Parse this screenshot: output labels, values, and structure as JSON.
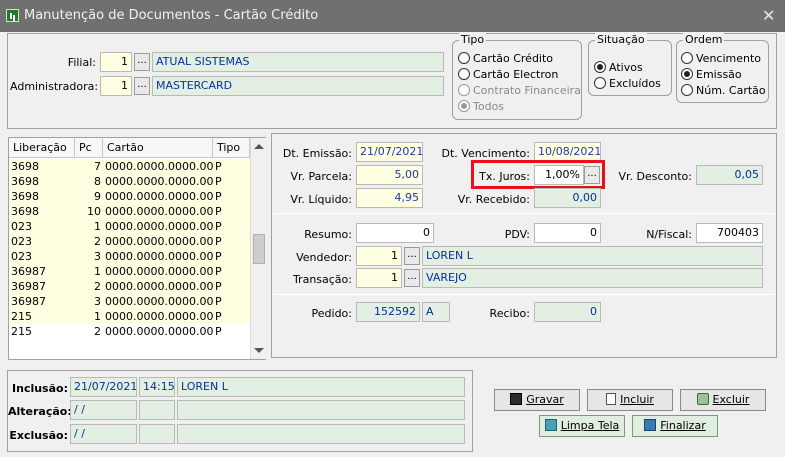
{
  "window": {
    "title": "Manutenção de Documentos - Cartão Crédito",
    "close": "✕"
  },
  "header": {
    "filial_label": "Filial:",
    "filial_code": "1",
    "filial_name": "ATUAL SISTEMAS",
    "adm_label": "Administradora:",
    "adm_code": "1",
    "adm_name": "MASTERCARD",
    "dots": "..."
  },
  "tipo": {
    "title": "Tipo",
    "options": [
      {
        "label": "Cartão Crédito",
        "selected": false,
        "enabled": true
      },
      {
        "label": "Cartão Electron",
        "selected": false,
        "enabled": true
      },
      {
        "label": "Contrato Financeira",
        "selected": false,
        "enabled": false
      },
      {
        "label": "Todos",
        "selected": true,
        "enabled": false
      }
    ]
  },
  "situacao": {
    "title": "Situação",
    "options": [
      {
        "label": "Ativos",
        "selected": true
      },
      {
        "label": "Excluídos",
        "selected": false
      }
    ]
  },
  "ordem": {
    "title": "Ordem",
    "options": [
      {
        "label": "Vencimento",
        "selected": false
      },
      {
        "label": "Emissão",
        "selected": true
      },
      {
        "label": "Núm. Cartão",
        "selected": false
      }
    ]
  },
  "grid": {
    "columns": [
      "Liberação",
      "Pc",
      "Cartão",
      "Tipo"
    ],
    "rows": [
      [
        "3698",
        "7",
        "0000.0000.0000.0000",
        "P"
      ],
      [
        "3698",
        "8",
        "0000.0000.0000.0000",
        "P"
      ],
      [
        "3698",
        "9",
        "0000.0000.0000.0000",
        "P"
      ],
      [
        "3698",
        "10",
        "0000.0000.0000.0000",
        "P"
      ],
      [
        "023",
        "1",
        "0000.0000.0000.0000",
        "P"
      ],
      [
        "023",
        "2",
        "0000.0000.0000.0000",
        "P"
      ],
      [
        "023",
        "3",
        "0000.0000.0000.0000",
        "P"
      ],
      [
        "36987",
        "1",
        "0000.0000.0000.0000",
        "P"
      ],
      [
        "36987",
        "2",
        "0000.0000.0000.0000",
        "P"
      ],
      [
        "36987",
        "3",
        "0000.0000.0000.0000",
        "P"
      ],
      [
        "215",
        "1",
        "0000.0000.0000.0000",
        "P"
      ],
      [
        "215",
        "2",
        "0000.0000.0000.0000",
        "P"
      ]
    ],
    "selected_row": 11
  },
  "detail": {
    "dt_emissao_label": "Dt. Emissão:",
    "dt_emissao": "21/07/2021",
    "dt_vencimento_label": "Dt. Vencimento:",
    "dt_vencimento": "10/08/2021",
    "vr_parcela_label": "Vr. Parcela:",
    "vr_parcela": "5,00",
    "tx_juros_label": "Tx. Juros:",
    "tx_juros": "1,00%",
    "vr_desconto_label": "Vr. Desconto:",
    "vr_desconto": "0,05",
    "vr_liquido_label": "Vr. Líquido:",
    "vr_liquido": "4,95",
    "vr_recebido_label": "Vr. Recebido:",
    "vr_recebido": "0,00",
    "resumo_label": "Resumo:",
    "resumo": "0",
    "pdv_label": "PDV:",
    "pdv": "0",
    "nfiscal_label": "N/Fiscal:",
    "nfiscal": "700403",
    "vendedor_label": "Vendedor:",
    "vendedor_code": "1",
    "vendedor_name": "LOREN L",
    "transacao_label": "Transação:",
    "transacao_code": "1",
    "transacao_name": "VAREJO",
    "pedido_label": "Pedido:",
    "pedido": "152592",
    "pedido_tipo": "A",
    "recibo_label": "Recibo:",
    "recibo": "0"
  },
  "audit": {
    "inclusao_label": "Inclusão:",
    "inclusao_date": "21/07/2021",
    "inclusao_time": "14:15",
    "inclusao_user": "LOREN L",
    "alteracao_label": "Alteração:",
    "alteracao_date": " / /",
    "exclusao_label": "Exclusão:",
    "exclusao_date": " / /"
  },
  "buttons": {
    "gravar": "Gravar",
    "incluir": "Incluir",
    "excluir": "Excluir",
    "limpa_tela": "Limpa Tela",
    "finalizar": "Finalizar"
  },
  "colors": {
    "highlight": "#e8101a",
    "field_yellow": "#ffffe1",
    "field_green": "#e3efe3"
  }
}
